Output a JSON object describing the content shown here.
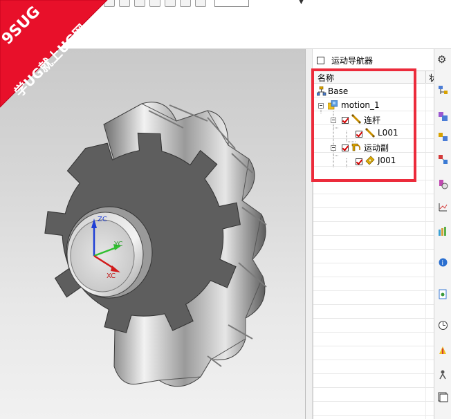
{
  "banner": {
    "line1": "9SUG",
    "line2": "学UG就上UG网",
    "color": "#e8102a"
  },
  "navigator": {
    "title": "运动导航器",
    "column_name": "名称",
    "column_second": "状",
    "tree": [
      {
        "label": "Base",
        "level": 0,
        "icon": "assembly-base-icon",
        "checkbox": false,
        "expander": false
      },
      {
        "label": "motion_1",
        "level": 0,
        "icon": "motion-simulation-icon",
        "checkbox": false,
        "expander": true
      },
      {
        "label": "连杆",
        "level": 1,
        "icon": "link-folder-icon",
        "checkbox": true,
        "expander": true
      },
      {
        "label": "L001",
        "level": 2,
        "icon": "link-icon",
        "checkbox": true,
        "expander": false
      },
      {
        "label": "运动副",
        "level": 1,
        "icon": "joint-folder-icon",
        "checkbox": true,
        "expander": true
      },
      {
        "label": "J001",
        "level": 2,
        "icon": "joint-icon",
        "checkbox": true,
        "expander": false
      }
    ]
  },
  "viewport": {
    "axes": {
      "z": "ZC",
      "y": "YC",
      "x": "XC"
    },
    "background_top": "#c9c9c9",
    "background_bottom": "#f1f1f1"
  },
  "right_toolbar_icons": [
    "settings-gear-icon",
    "assembly-navigator-icon",
    "constraint-navigator-icon",
    "part-navigator-icon",
    "reuse-library-icon",
    "hd3d-tools-icon",
    "web-browser-icon",
    "history-icon",
    "system-materials-icon",
    "process-studio-icon",
    "roles-icon",
    "motion-navigator-icon"
  ],
  "highlight_color": "#ec2b3b"
}
